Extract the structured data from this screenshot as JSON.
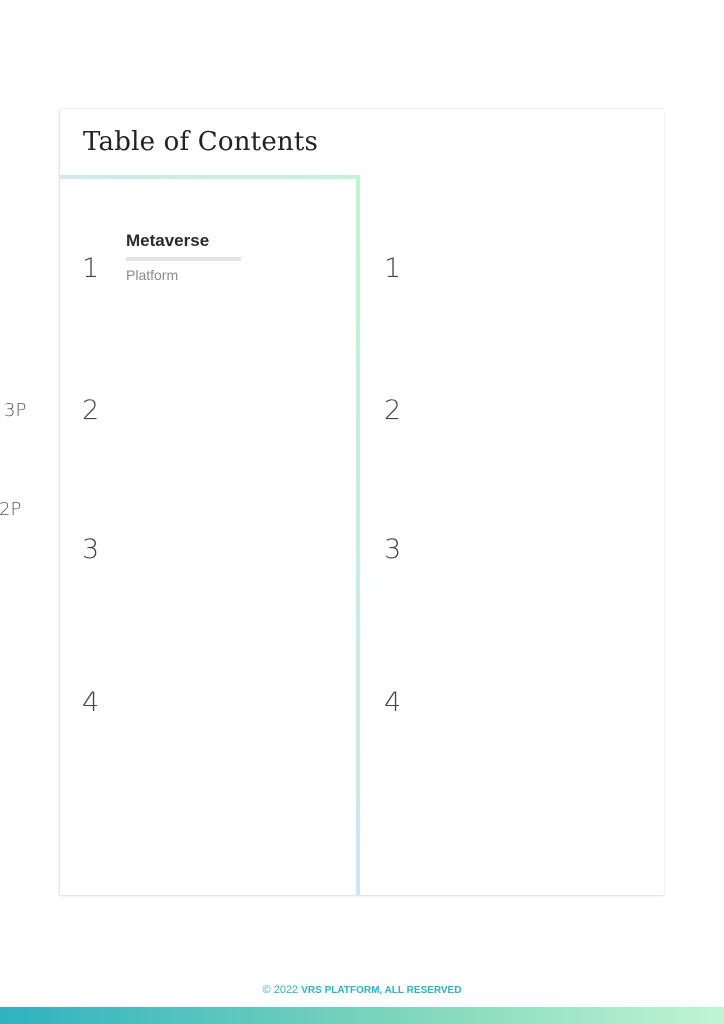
{
  "side_notes": [
    "3P",
    "2P"
  ],
  "toc": {
    "title": "Table of Contents",
    "left_numbers": [
      "1",
      "2",
      "3",
      "4"
    ],
    "right_numbers": [
      "1",
      "2",
      "3",
      "4"
    ],
    "first_entry": {
      "title": "Metaverse",
      "subtitle": "Platform"
    }
  },
  "footer": {
    "copyright": "© 2022",
    "brand": "VRS PLATFORM, ALL RESERVED"
  },
  "colors": {
    "accent": "#2bb3c6",
    "gradient_start": "#2fb2c1",
    "gradient_end": "#c0f5d2"
  }
}
